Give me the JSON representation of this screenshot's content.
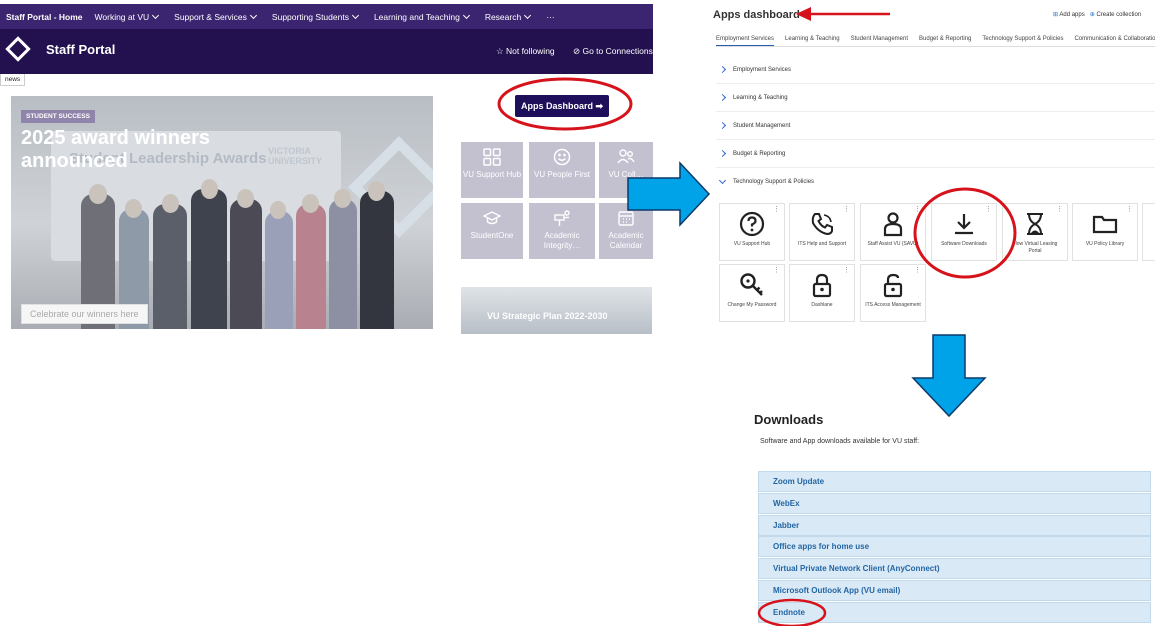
{
  "portal": {
    "home_label": "Staff Portal - Home",
    "nav": [
      "Working at VU",
      "Support & Services",
      "Supporting Students",
      "Learning and Teaching",
      "Research"
    ],
    "nav_more": "···",
    "site_title": "Staff Portal",
    "not_following": "Not following",
    "go_to_connections": "Go to Connections",
    "news_label": "news",
    "hero": {
      "tag": "STUDENT SUCCESS",
      "title": "2025 award winners announced",
      "board_text": "Student Leadership Awards",
      "brand_text": "VICTORIA UNIVERSITY",
      "button": "Celebrate our winners here"
    },
    "apps_dashboard_button": "Apps Dashboard ➡",
    "tiles": [
      {
        "label": "VU Support Hub",
        "icon": "grid-icon"
      },
      {
        "label": "VU People First",
        "icon": "smile-icon"
      },
      {
        "label": "VU Coll…",
        "icon": "people-icon"
      },
      {
        "label": "StudentOne",
        "icon": "graduation-cap-icon"
      },
      {
        "label": "Academic Integrity…",
        "icon": "tool-icon"
      },
      {
        "label": "Academic Calendar",
        "icon": "calendar-icon"
      }
    ],
    "strategic_plan": "VU Strategic Plan 2022-2030"
  },
  "apps_dashboard": {
    "title": "Apps dashboard",
    "add_apps": "Add apps",
    "create_collection": "Create collection",
    "tabs": [
      "Employment Services",
      "Learning & Teaching",
      "Student Management",
      "Budget & Reporting",
      "Technology Support & Policies",
      "Communication & Collaboration"
    ],
    "categories": [
      "Employment Services",
      "Learning & Teaching",
      "Student Management",
      "Budget & Reporting",
      "Technology Support & Policies"
    ],
    "apps": [
      {
        "label": "VU Support Hub",
        "icon": "question-circle-icon"
      },
      {
        "label": "ITS Help and Support",
        "icon": "phone-icon"
      },
      {
        "label": "Staff Assist VU (SAVU)",
        "icon": "person-icon"
      },
      {
        "label": "Software Downloads",
        "icon": "download-icon"
      },
      {
        "label": "Flow Virtual Leasing Portal",
        "icon": "hourglass-icon"
      },
      {
        "label": "VU Policy Library",
        "icon": "folder-icon"
      },
      {
        "label": "Change My Password",
        "icon": "key-icon"
      },
      {
        "label": "Dashlane",
        "icon": "lock-icon"
      },
      {
        "label": "ITS Access Management",
        "icon": "unlock-icon"
      }
    ]
  },
  "downloads": {
    "title": "Downloads",
    "subtitle": "Software and App downloads available for VU staff:",
    "items": [
      "Zoom Update",
      "WebEx",
      "Jabber",
      "Office apps for home use",
      "Virtual Private Network Client (AnyConnect)",
      "Microsoft Outlook App (VU email)",
      "Endnote"
    ]
  },
  "colors": {
    "suite_bar": "#3b2470",
    "header": "#23114f",
    "tile": "#c3c0d0",
    "annotation_red": "#d6131b",
    "annotation_blue": "#00a3e8",
    "download_item": "#d9e9f6"
  }
}
